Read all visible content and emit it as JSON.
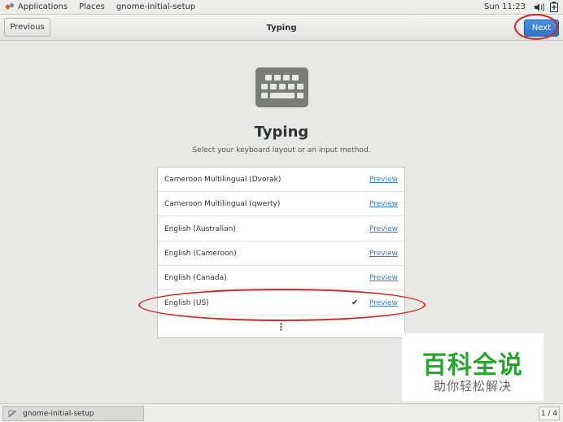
{
  "topbar": {
    "applications_label": "Applications",
    "places_label": "Places",
    "window_label": "gnome-initial-setup",
    "clock": "Sun 11:23",
    "volume_icon": "volume-icon",
    "power_icon": "battery-icon"
  },
  "header": {
    "previous_label": "Previous",
    "title": "Typing",
    "next_label": "Next"
  },
  "main": {
    "icon": "keyboard-icon",
    "title": "Typing",
    "subtitle": "Select your keyboard layout or an input method.",
    "layouts": [
      {
        "name": "Cameroon Multilingual (Dvorak)",
        "preview": "Preview",
        "selected": false
      },
      {
        "name": "Cameroon Multilingual (qwerty)",
        "preview": "Preview",
        "selected": false
      },
      {
        "name": "English (Australian)",
        "preview": "Preview",
        "selected": false
      },
      {
        "name": "English (Cameroon)",
        "preview": "Preview",
        "selected": false
      },
      {
        "name": "English (Canada)",
        "preview": "Preview",
        "selected": false
      },
      {
        "name": "English (US)",
        "preview": "Preview",
        "selected": true
      }
    ],
    "more_symbol": "⋮"
  },
  "watermark": {
    "main": "百科全说",
    "sub": "助你轻松解决"
  },
  "taskbar": {
    "task_label": "gnome-initial-setup",
    "workspace": "1 / 4"
  },
  "colors": {
    "accent": "#3584e4",
    "annotation": "#d42424",
    "watermark_green": "#27a52d"
  }
}
